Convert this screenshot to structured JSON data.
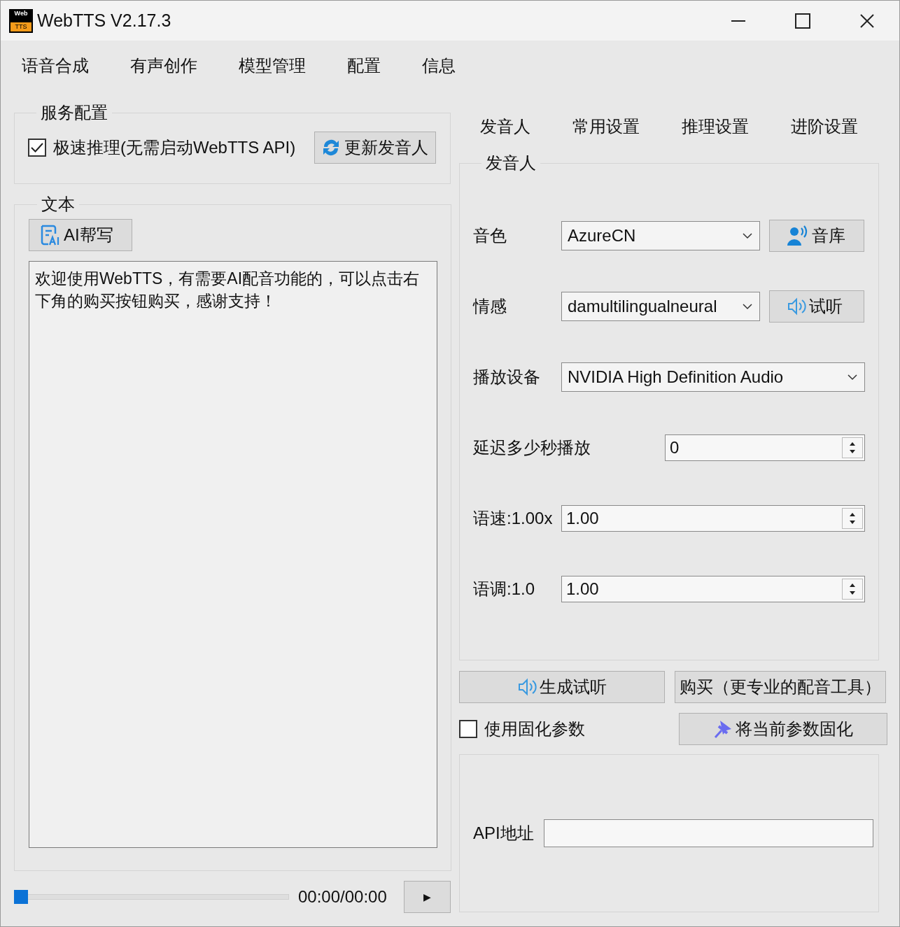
{
  "window": {
    "title": "WebTTS V2.17.3",
    "logo_top": "Web",
    "logo_bottom": "TTS"
  },
  "menu": [
    "语音合成",
    "有声创作",
    "模型管理",
    "配置",
    "信息"
  ],
  "service_config": {
    "title": "服务配置",
    "fast_inference": {
      "label": "极速推理(无需启动WebTTS API)",
      "checked": true
    },
    "refresh_button": "更新发音人"
  },
  "text_panel": {
    "title": "文本",
    "ai_button": "AI帮写",
    "content": "欢迎使用WebTTS，有需要AI配音功能的，可以点击右下角的购买按钮购买，感谢支持！"
  },
  "player": {
    "level": 0,
    "time": "00:00/00:00",
    "play_button": "▶"
  },
  "settings_tabs": [
    "发音人",
    "常用设置",
    "推理设置",
    "进阶设置"
  ],
  "speaker_group": {
    "title": "发音人",
    "rows": [
      {
        "kind": "select",
        "label": "音色",
        "value": "AzureCN",
        "button": "音库"
      },
      {
        "kind": "select",
        "label": "情感",
        "value": "damultilingualneural",
        "button": "试听"
      },
      {
        "kind": "select",
        "label": "播放设备",
        "value": "NVIDIA High Definition Audio"
      },
      {
        "kind": "spin",
        "label": "延迟多少秒播放",
        "value": "0"
      },
      {
        "kind": "spin",
        "label": "语速:1.00x",
        "value": "1.00"
      },
      {
        "kind": "spin",
        "label": "语调:1.0",
        "value": "1.00"
      }
    ]
  },
  "actions": {
    "preview_button": "生成试听",
    "buy_button": "购买（更专业的配音工具）",
    "fixed_params": {
      "label": "使用固化参数",
      "checked": false
    },
    "fix_button": "将当前参数固化"
  },
  "api": {
    "label": "API地址"
  }
}
